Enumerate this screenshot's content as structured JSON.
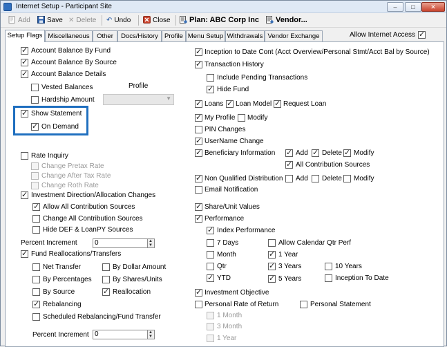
{
  "window": {
    "title": "Internet Setup - Participant Site",
    "controls": {
      "minimize": "–",
      "maximize": "□",
      "close": "✕"
    }
  },
  "toolbar": {
    "add": "Add",
    "save": "Save",
    "delete": "Delete",
    "undo": "Undo",
    "close": "Close",
    "plan": "Plan: ABC Corp Inc",
    "vendor": "Vendor..."
  },
  "tabs": [
    "Setup Flags",
    "Miscellaneous",
    "Other",
    "Docs/History",
    "Profile",
    "Menu Setup",
    "Withdrawals",
    "Vendor Exchange"
  ],
  "allow_internet_access": {
    "label": "Allow Internet Access",
    "checked": true
  },
  "left": {
    "account_balance_by_fund": {
      "label": "Account Balance By Fund",
      "checked": true
    },
    "account_balance_by_source": {
      "label": "Account Balance By Source",
      "checked": true
    },
    "account_balance_details": {
      "label": "Account Balance Details",
      "checked": true
    },
    "vested_balances": {
      "label": "Vested Balances",
      "checked": false
    },
    "hardship_amount": {
      "label": "Hardship Amount",
      "checked": false
    },
    "profile_label": "Profile",
    "show_statement": {
      "label": "Show Statement",
      "checked": true
    },
    "on_demand": {
      "label": "On Demand",
      "checked": true
    },
    "rate_inquiry": {
      "label": "Rate Inquiry",
      "checked": false
    },
    "change_pretax_rate": {
      "label": "Change Pretax Rate",
      "checked": false
    },
    "change_after_tax_rate": {
      "label": "Change After Tax Rate",
      "checked": false
    },
    "change_roth_rate": {
      "label": "Change Roth Rate",
      "checked": false
    },
    "investment_direction": {
      "label": "Investment Direction/Allocation Changes",
      "checked": true
    },
    "allow_all_contribution_sources": {
      "label": "Allow All Contribution Sources",
      "checked": true
    },
    "change_all_contribution_sources": {
      "label": "Change All Contribution Sources",
      "checked": false
    },
    "hide_def_loanpy": {
      "label": "Hide DEF & LoanPY Sources",
      "checked": false
    },
    "percent_increment_label": "Percent Increment",
    "percent_increment_value": "0",
    "fund_reallocations": {
      "label": "Fund Reallocations/Transfers",
      "checked": true
    },
    "net_transfer": {
      "label": "Net Transfer",
      "checked": false
    },
    "by_dollar_amount": {
      "label": "By Dollar Amount",
      "checked": false
    },
    "by_percentages": {
      "label": "By Percentages",
      "checked": false
    },
    "by_shares_units": {
      "label": "By Shares/Units",
      "checked": false
    },
    "by_source": {
      "label": "By Source",
      "checked": false
    },
    "reallocation": {
      "label": "Reallocation",
      "checked": true
    },
    "rebalancing": {
      "label": "Rebalancing",
      "checked": true
    },
    "scheduled_rebalancing": {
      "label": "Scheduled Rebalancing/Fund Transfer",
      "checked": false
    },
    "percent_increment2_label": "Percent Increment",
    "percent_increment2_value": "0"
  },
  "right": {
    "inception_to_date": {
      "label": "Inception to Date Cont (Acct Overview/Personal Stmt/Acct Bal by Source)",
      "checked": true
    },
    "transaction_history": {
      "label": "Transaction History",
      "checked": true
    },
    "include_pending": {
      "label": "Include Pending Transactions",
      "checked": false
    },
    "hide_fund": {
      "label": "Hide Fund",
      "checked": true
    },
    "loans": {
      "label": "Loans",
      "checked": true
    },
    "loan_model": {
      "label": "Loan Model",
      "checked": true
    },
    "request_loan": {
      "label": "Request Loan",
      "checked": true
    },
    "my_profile": {
      "label": "My Profile",
      "checked": true
    },
    "modify": {
      "label": "Modify",
      "checked": false
    },
    "pin_changes": {
      "label": "PIN Changes",
      "checked": false
    },
    "username_change": {
      "label": "UserName Change",
      "checked": true
    },
    "beneficiary_information": {
      "label": "Beneficiary Information",
      "checked": true
    },
    "ben_add": {
      "label": "Add",
      "checked": true
    },
    "ben_delete": {
      "label": "Delete",
      "checked": true
    },
    "ben_modify": {
      "label": "Modify",
      "checked": true
    },
    "all_contribution_sources": {
      "label": "All Contribution Sources",
      "checked": true
    },
    "non_qualified_distribution": {
      "label": "Non Qualified Distribution",
      "checked": true
    },
    "nqd_add": {
      "label": "Add",
      "checked": false
    },
    "nqd_delete": {
      "label": "Delete",
      "checked": false
    },
    "nqd_modify": {
      "label": "Modify",
      "checked": false
    },
    "email_notification": {
      "label": "Email Notification",
      "checked": false
    },
    "share_unit_values": {
      "label": "Share/Unit Values",
      "checked": true
    },
    "performance": {
      "label": "Performance",
      "checked": true
    },
    "index_performance": {
      "label": "Index Performance",
      "checked": true
    },
    "seven_days": {
      "label": "7 Days",
      "checked": false
    },
    "allow_calendar_qtr_perf": {
      "label": "Allow Calendar Qtr Perf",
      "checked": false
    },
    "month": {
      "label": "Month",
      "checked": false
    },
    "one_year": {
      "label": "1 Year",
      "checked": true
    },
    "qtr": {
      "label": "Qtr",
      "checked": false
    },
    "three_years": {
      "label": "3 Years",
      "checked": true
    },
    "ten_years": {
      "label": "10 Years",
      "checked": false
    },
    "ytd": {
      "label": "YTD",
      "checked": true
    },
    "five_years": {
      "label": "5 Years",
      "checked": true
    },
    "inception_to_date_perf": {
      "label": "Inception To Date",
      "checked": false
    },
    "investment_objective": {
      "label": "Investment Objective",
      "checked": true
    },
    "personal_rate_of_return": {
      "label": "Personal Rate of Return",
      "checked": false
    },
    "personal_statement": {
      "label": "Personal Statement",
      "checked": false
    },
    "prr_1_month": {
      "label": "1 Month",
      "checked": false
    },
    "prr_3_month": {
      "label": "3 Month",
      "checked": false
    },
    "prr_1_year": {
      "label": "1 Year",
      "checked": false
    }
  },
  "colors": {
    "highlight_border": "#1f6fbf",
    "close_button": "#c9442e"
  }
}
